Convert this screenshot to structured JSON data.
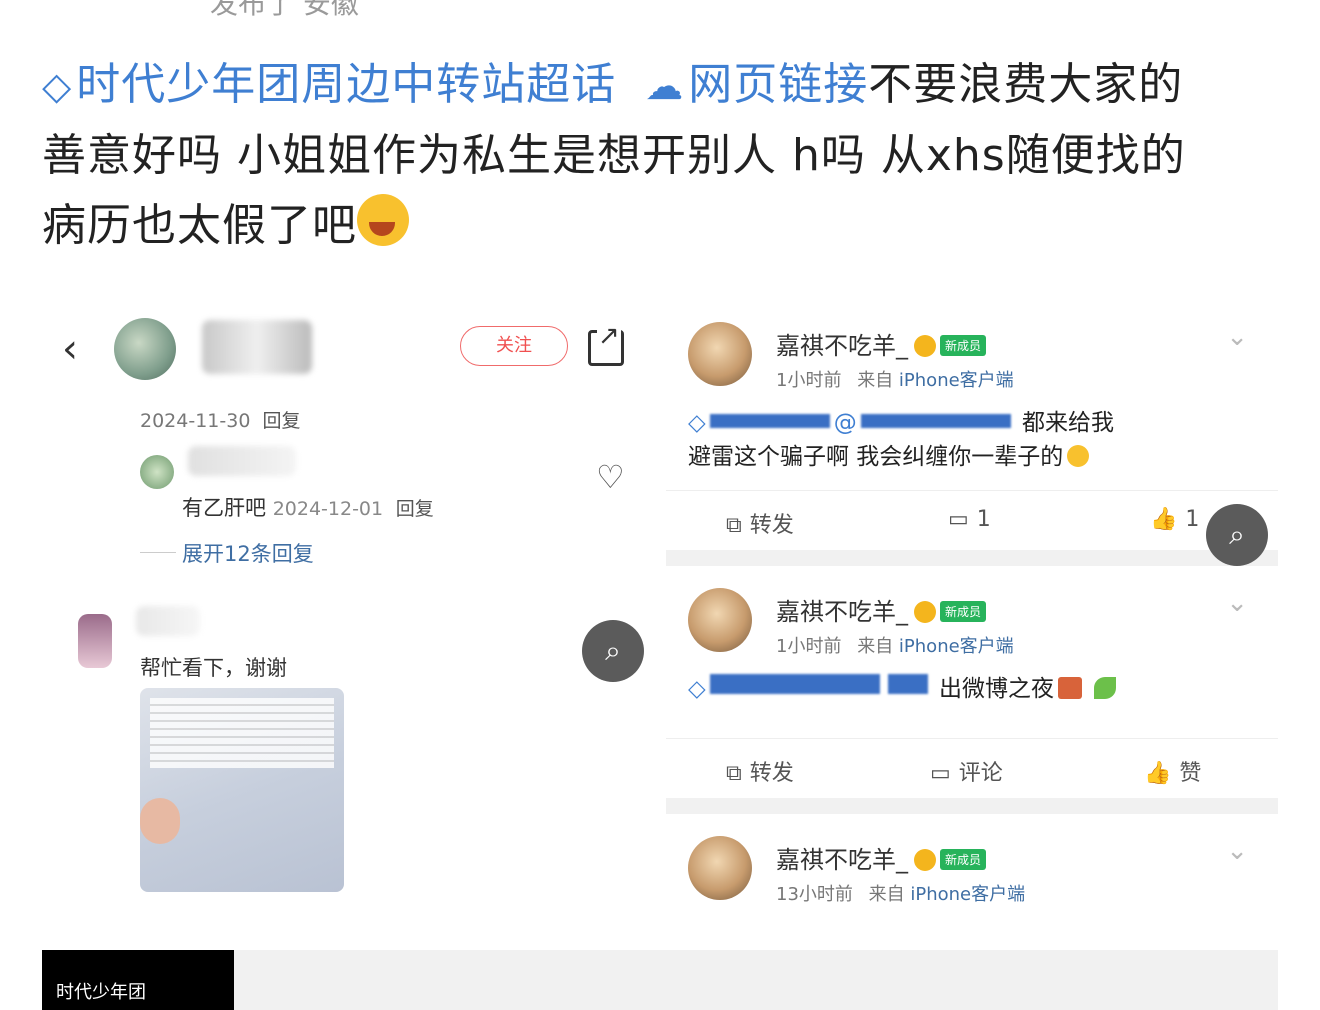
{
  "header": {
    "cut_text": "发布了 安徽"
  },
  "post": {
    "topic_link": "时代少年团周边中转站超话",
    "web_link": "网页链接",
    "line1_rest": "不要浪费大家的",
    "line2": "善意好吗 小姐姐作为私生是想开别人 h吗 从xhs随便找的",
    "line3": "病历也太假了吧"
  },
  "left_panel": {
    "follow_label": "关注",
    "comment1_date": "2024-11-30",
    "reply_label": "回复",
    "reply_text": "有乙肝吧",
    "reply_date": "2024-12-01",
    "expand_label": "展开12条回复",
    "comment2_text": "帮忙看下，谢谢"
  },
  "right_panel": {
    "cards": [
      {
        "username": "嘉祺不吃羊_",
        "badge": "新成员",
        "time": "1小时前",
        "source_prefix": "来自",
        "source": "iPhone客户端",
        "body_line1_end": "都来给我",
        "body_line2": "避雷这个骗子啊 我会纠缠你一辈子的",
        "repost": "转发",
        "comment": "1",
        "like": "1"
      },
      {
        "username": "嘉祺不吃羊_",
        "badge": "新成员",
        "time": "1小时前",
        "source_prefix": "来自",
        "source": "iPhone客户端",
        "body_line1_end": "出微博之夜",
        "repost": "转发",
        "comment": "评论",
        "like": "赞"
      },
      {
        "username": "嘉祺不吃羊_",
        "badge": "新成员",
        "time": "13小时前",
        "source_prefix": "来自",
        "source": "iPhone客户端"
      }
    ]
  },
  "bottom": {
    "thumb_text": "时代少年团"
  },
  "colors": {
    "link": "#3f7fd2",
    "follow": "#f05050",
    "badge_new": "#27b35b"
  }
}
